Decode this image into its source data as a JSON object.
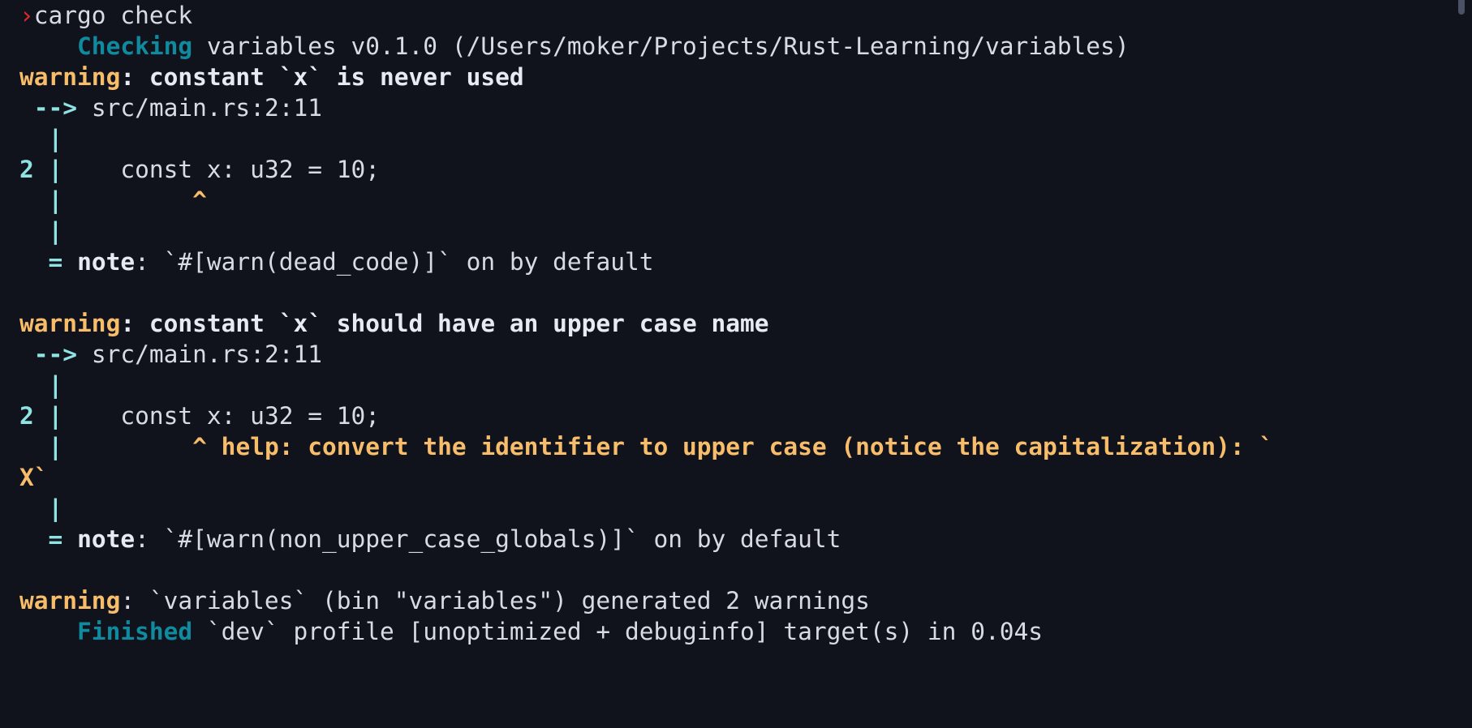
{
  "terminal": {
    "background": "#11131c",
    "foreground": "#d8dae6",
    "prompt_color": "#e02b2b",
    "warning_color": "#f8bd6a",
    "success_color": "#0f8a9e",
    "accent_cyan": "#8fe3e3",
    "prompt_symbol": "›",
    "command": "cargo check"
  },
  "lines": {
    "l1_cmd": "cargo check",
    "l2_checking_label": "Checking",
    "l2_checking_rest": " variables v0.1.0 (/Users/moker/Projects/Rust-Learning/variables)",
    "l3_warning_label": "warning",
    "l3_warning_rest": ": constant `x` is never used",
    "l4_arrow": "-->",
    "l4_location": " src/main.rs:2:11",
    "l5_pipe": "|",
    "l6_lineno": "2",
    "l6_pipe": "|",
    "l6_code": "    const x: u32 = 10;",
    "l7_pipe": "|",
    "l7_caret": "^",
    "l8_pipe": "|",
    "l9_eq": "=",
    "l9_note_label": "note",
    "l9_note_rest": ": `#[warn(dead_code)]` on by default",
    "l11_warning_label": "warning",
    "l11_warning_rest": ": constant `x` should have an upper case name",
    "l12_arrow": "-->",
    "l12_location": " src/main.rs:2:11",
    "l13_pipe": "|",
    "l14_lineno": "2",
    "l14_pipe": "|",
    "l14_code": "    const x: u32 = 10;",
    "l15_pipe": "|",
    "l15_help": "^ help: convert the identifier to upper case (notice the capitalization): `",
    "l16_wrap": "X`",
    "l17_pipe": "|",
    "l18_eq": "=",
    "l18_note_label": "note",
    "l18_note_rest": ": `#[warn(non_upper_case_globals)]` on by default",
    "l20_warning_label": "warning",
    "l20_warning_rest": ": `variables` (bin \"variables\") generated 2 warnings",
    "l21_finished_label": "Finished",
    "l21_finished_rest": " `dev` profile [unoptimized + debuginfo] target(s) in 0.04s"
  }
}
